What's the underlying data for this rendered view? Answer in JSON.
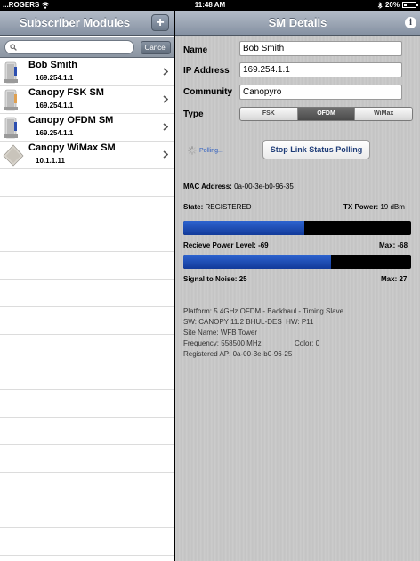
{
  "status_bar": {
    "carrier": "...ROGERS",
    "time": "11:48 AM",
    "battery": "20%",
    "battery_level": 0.2
  },
  "left_panel": {
    "title": "Subscriber Modules",
    "add_button": "+",
    "search": {
      "placeholder": "",
      "value": "",
      "cancel": "Cancel"
    },
    "items": [
      {
        "name": "Bob Smith",
        "ip": "169.254.1.1",
        "icon": "canopy-radio-icon"
      },
      {
        "name": "Canopy FSK SM",
        "ip": "169.254.1.1",
        "icon": "canopy-radio-icon"
      },
      {
        "name": "Canopy OFDM SM",
        "ip": "169.254.1.1",
        "icon": "canopy-radio-icon"
      },
      {
        "name": "Canopy WiMax SM",
        "ip": "10.1.1.11",
        "icon": "wimax-radio-icon"
      }
    ]
  },
  "details": {
    "title": "SM Details",
    "info_button": "i",
    "form": {
      "name_label": "Name",
      "name_value": "Bob Smith",
      "ip_label": "IP Address",
      "ip_value": "169.254.1.1",
      "community_label": "Community",
      "community_value": "Canopyro",
      "type_label": "Type",
      "type_options": [
        "FSK",
        "OFDM",
        "WiMax"
      ],
      "type_selected": "OFDM"
    },
    "polling": {
      "status": "Polling...",
      "button": "Stop Link Status Polling"
    },
    "mac_label": "MAC Address:",
    "mac_value": "0a-00-3e-b0-96-35",
    "state_label": "State:",
    "state_value": "REGISTERED",
    "tx_power_label": "TX Power:",
    "tx_power_value": "19 dBm",
    "receive_power": {
      "label": "Recieve Power Level:",
      "value": "-69",
      "max_label": "Max:",
      "max_value": "-68",
      "level": 0.53
    },
    "signal_to_noise": {
      "label": "Signal to Noise:",
      "value": "25",
      "max_label": "Max:",
      "max_value": "27",
      "level": 0.65
    },
    "platform_label": "Platform:",
    "platform_value": "5.4GHz OFDM - Backhaul - Timing Slave",
    "sw_label": "SW:",
    "sw_value": "CANOPY 11.2 BHUL-DES",
    "hw_label": "HW:",
    "hw_value": "P11",
    "site_name_label": "Site Name:",
    "site_name_value": "WFB Tower",
    "frequency_label": "Frequency:",
    "frequency_value": "558500 MHz",
    "color_label": "Color:",
    "color_value": "0",
    "registered_ap_label": "Registered AP:",
    "registered_ap_value": "0a-00-3e-b0-96-25"
  },
  "colors": {
    "nav_bar": "#8c97a8",
    "bar_fill": "#1d4db5",
    "bar_track": "#000000",
    "polling_text": "#2f5fc0"
  }
}
